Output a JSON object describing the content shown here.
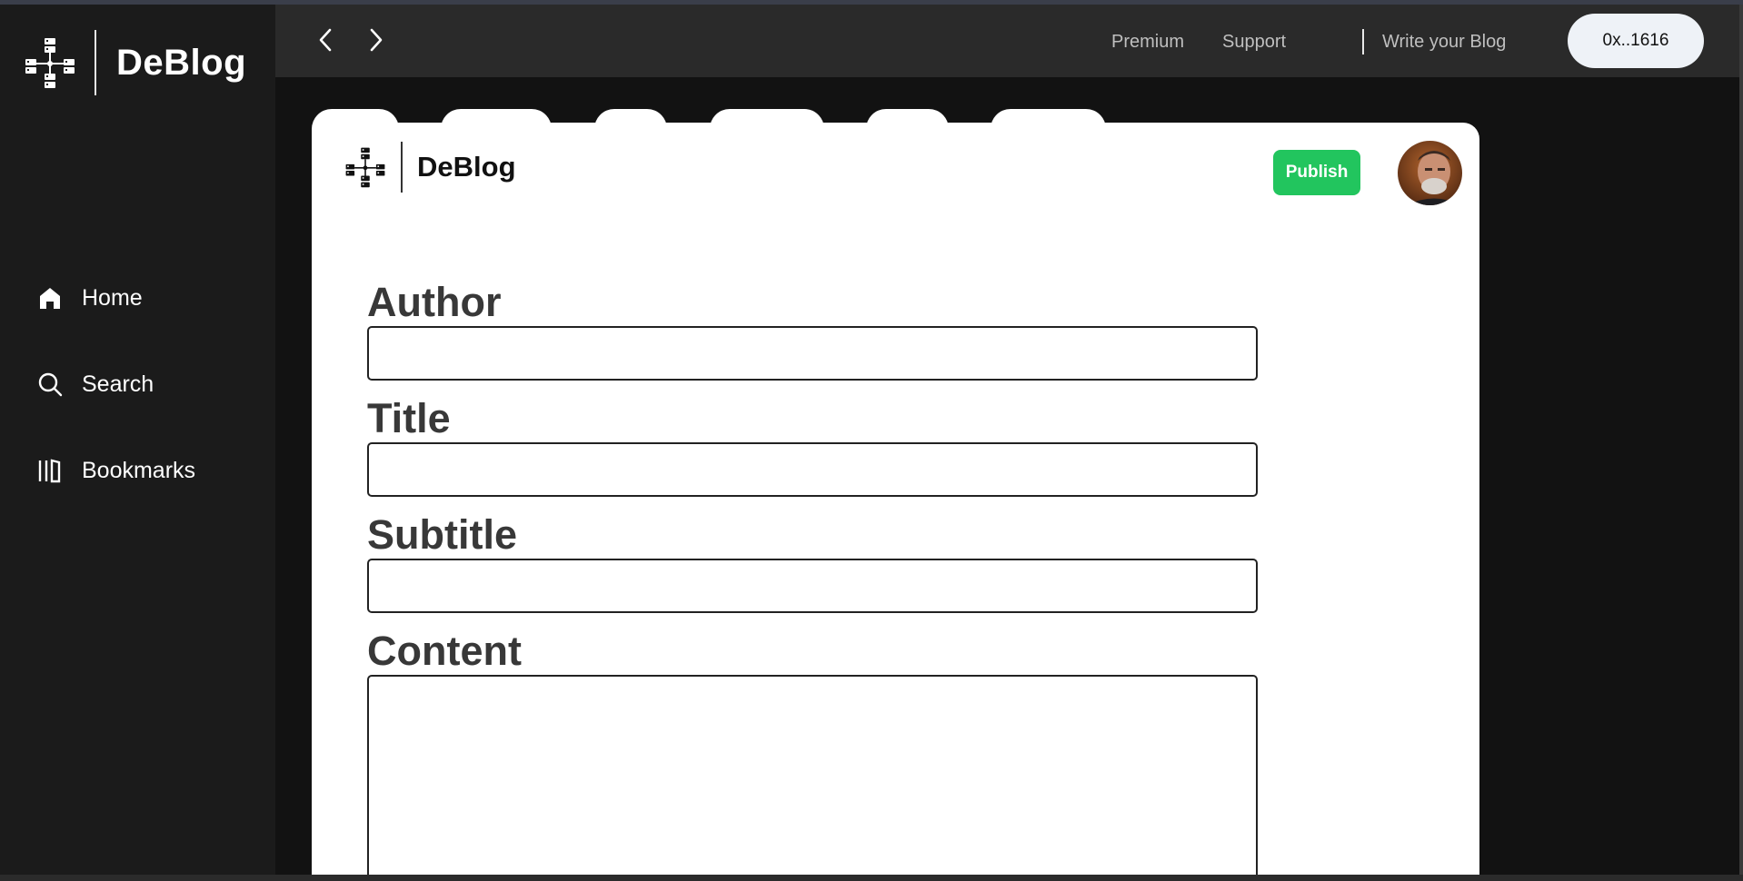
{
  "app": {
    "brand": "DeBlog"
  },
  "sidebar": {
    "items": [
      {
        "label": "Home",
        "icon": "home-icon"
      },
      {
        "label": "Search",
        "icon": "search-icon"
      },
      {
        "label": "Bookmarks",
        "icon": "bookmarks-icon"
      }
    ]
  },
  "topbar": {
    "back_icon": "chevron-left-icon",
    "forward_icon": "chevron-right-icon",
    "premium": "Premium",
    "support": "Support",
    "write": "Write your Blog",
    "wallet": "0x..1616"
  },
  "editor": {
    "brand": "DeBlog",
    "publish": "Publish",
    "fields": {
      "author": {
        "label": "Author",
        "value": ""
      },
      "title": {
        "label": "Title",
        "value": ""
      },
      "subtitle": {
        "label": "Subtitle",
        "value": ""
      },
      "content": {
        "label": "Content",
        "value": ""
      }
    }
  },
  "colors": {
    "accent_publish": "#22c55e",
    "sidebar_bg": "#1b1b1b",
    "topbar_bg": "#2a2a2a",
    "page_bg": "#121212"
  }
}
